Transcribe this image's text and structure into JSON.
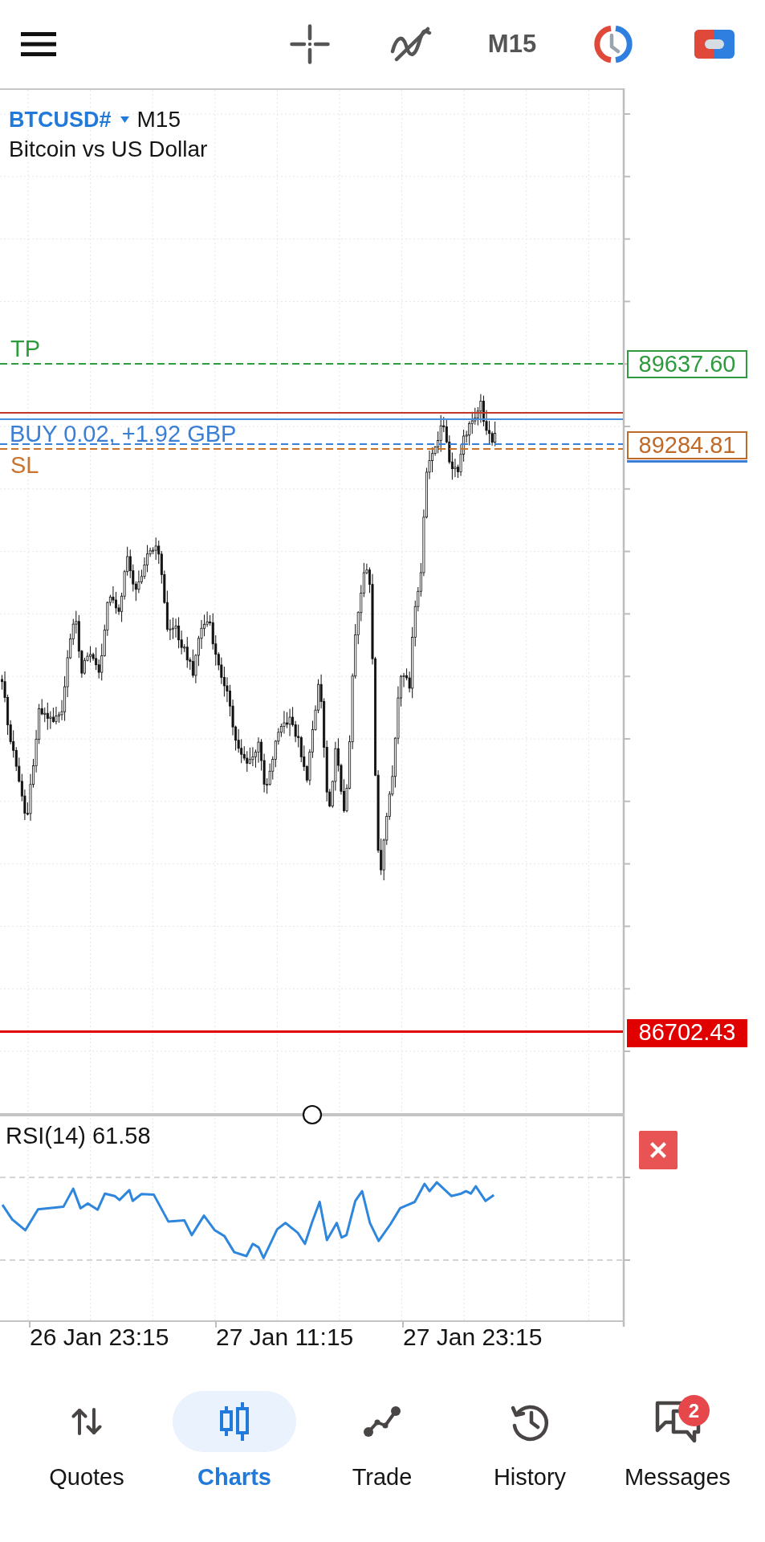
{
  "toolbar": {
    "timeframe": "M15"
  },
  "chart": {
    "symbol": "BTCUSD#",
    "timeframe": "M15",
    "description": "Bitcoin vs US Dollar",
    "lines": [
      {
        "kind": "dashed",
        "color": "#2e9b3e",
        "label": "TP"
      },
      {
        "kind": "solid",
        "color": "#c0392b"
      },
      {
        "kind": "solid",
        "color": "#4a8fdb"
      },
      {
        "kind": "dashed",
        "color": "#3a7fd5",
        "label": "BUY 0.02, +1.92 GBP"
      },
      {
        "kind": "dashed",
        "color": "#c8732e",
        "label": "SL"
      },
      {
        "kind": "solid",
        "color": "#e00000"
      }
    ],
    "price_tags": [
      {
        "kind": "outline",
        "color": "#2e9b3e",
        "text": "89637.60"
      },
      {
        "kind": "outline",
        "color": "#c06a2a",
        "text": "89284.81"
      },
      {
        "kind": "marker",
        "color": "#3a7fd5"
      },
      {
        "kind": "filled",
        "color": "#e00000",
        "text": "86702.43"
      }
    ]
  },
  "indicator": {
    "label": "RSI(14) 61.58"
  },
  "time_axis": {
    "labels": [
      "26 Jan 23:15",
      "27 Jan 11:15",
      "27 Jan 23:15"
    ]
  },
  "nav": [
    {
      "label": "Quotes",
      "selected": false
    },
    {
      "label": "Charts",
      "selected": true
    },
    {
      "label": "Trade",
      "selected": false
    },
    {
      "label": "History",
      "selected": false
    },
    {
      "label": "Messages",
      "selected": false,
      "badge": "2"
    }
  ]
}
